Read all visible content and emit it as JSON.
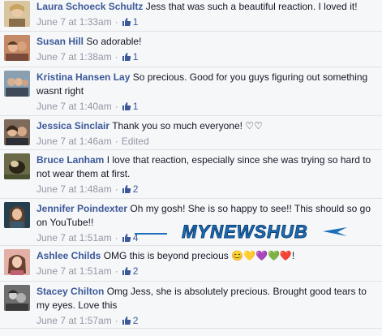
{
  "comments": [
    {
      "name": "Laura Schoeck Schultz",
      "text": "Jess that was such a beautiful reaction. I loved it!",
      "time": "June 7 at 1:33am",
      "likes": "1",
      "avatar_color": "#c9b48a"
    },
    {
      "name": "Susan Hill",
      "text": "So adorable!",
      "time": "June 7 at 1:38am",
      "likes": "1",
      "avatar_color": "#b8725a"
    },
    {
      "name": "Kristina Hansen Lay",
      "text": "So precious. Good for you guys figuring out something wasnt right",
      "time": "June 7 at 1:40am",
      "likes": "1",
      "avatar_color": "#7a8fa0"
    },
    {
      "name": "Jessica Sinclair",
      "text": "Thank you so much everyone! ♡♡",
      "time": "June 7 at 1:46am",
      "edited": "Edited",
      "avatar_color": "#6b5a4e"
    },
    {
      "name": "Bruce Lanham",
      "text": "I love that reaction, especially since she was trying so hard to not wear them at first.",
      "time": "June 7 at 1:48am",
      "likes": "2",
      "avatar_color": "#5a6040"
    },
    {
      "name": "Jennifer Poindexter",
      "text": "Oh my gosh! She is so happy to see!! This should so go on YouTube!!",
      "time": "June 7 at 1:51am",
      "likes": "4",
      "avatar_color": "#2f4a5a"
    },
    {
      "name": "Ashlee Childs",
      "text": "OMG this is beyond precious",
      "emoji": "😊💛💜💚❤️",
      "text_end": "!",
      "time": "June 7 at 1:51am",
      "likes": "2",
      "avatar_color": "#c9928a"
    },
    {
      "name": "Stacey Chilton",
      "text": "Omg Jess, she is absolutely precious. Brought good tears to my eyes. Love this",
      "time": "June 7 at 1:57am",
      "likes": "2",
      "avatar_color": "#555555"
    }
  ],
  "watermark": {
    "text": "MYNEWSHUB",
    "color": "#1c6fb8"
  },
  "colors": {
    "name": "#3b5998",
    "meta": "#9197a3",
    "background": "#f6f7f9"
  },
  "icons": {
    "like": "thumbs-up-icon"
  }
}
